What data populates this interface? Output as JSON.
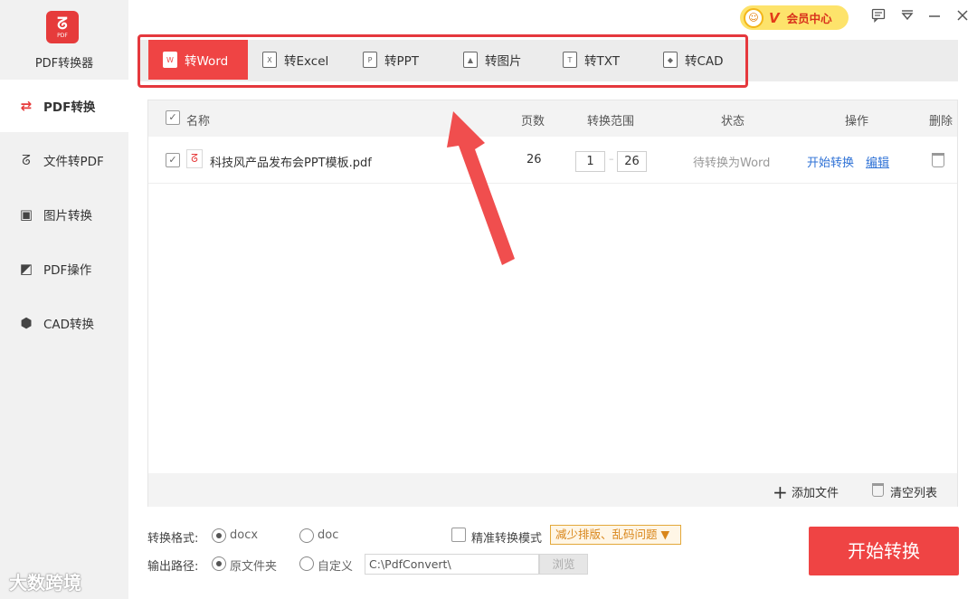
{
  "app": {
    "title": "PDF转换器",
    "logo_text": "PDF",
    "accent": "#ef4444"
  },
  "titlebar": {
    "vip_label": "会员中心",
    "vip_badge": "V",
    "icons": [
      "feedback-icon",
      "menu-dropdown-icon",
      "minimize-icon",
      "close-icon"
    ]
  },
  "sidebar": {
    "items": [
      {
        "label": "PDF转换",
        "icon": "pdf-convert-icon",
        "active": true
      },
      {
        "label": "文件转PDF",
        "icon": "file-to-pdf-icon"
      },
      {
        "label": "图片转换",
        "icon": "image-icon"
      },
      {
        "label": "PDF操作",
        "icon": "pdf-edit-icon"
      },
      {
        "label": "CAD转换",
        "icon": "cad-icon"
      }
    ]
  },
  "tabs": [
    {
      "label": "转Word",
      "icon": "W",
      "active": true
    },
    {
      "label": "转Excel",
      "icon": "X"
    },
    {
      "label": "转PPT",
      "icon": "P"
    },
    {
      "label": "转图片",
      "icon": "▲"
    },
    {
      "label": "转TXT",
      "icon": "T"
    },
    {
      "label": "转CAD",
      "icon": "◆"
    }
  ],
  "table": {
    "headers": {
      "name": "名称",
      "pages": "页数",
      "range": "转换范围",
      "status": "状态",
      "action": "操作",
      "delete": "删除"
    },
    "rows": [
      {
        "checked": true,
        "name": "科技风产品发布会PPT模板.pdf",
        "pages": "26",
        "range_from": "1",
        "range_to": "26",
        "status": "待转换为Word",
        "start": "开始转换",
        "edit": "编辑"
      }
    ]
  },
  "footer": {
    "add_file": "添加文件",
    "clear_list": "清空列表"
  },
  "options": {
    "format_label": "转换格式:",
    "format_docx": "docx",
    "format_doc": "doc",
    "format_selected": "docx",
    "precise_mode": "精准转换模式",
    "precise_tag": "减少排版、乱码问题",
    "output_label": "输出路径:",
    "output_original": "原文件夹",
    "output_custom": "自定义",
    "output_selected": "原文件夹",
    "path_value": "C:\\PdfConvert\\",
    "browse": "浏览"
  },
  "start_button": "开始转换",
  "watermark": "大数跨境"
}
